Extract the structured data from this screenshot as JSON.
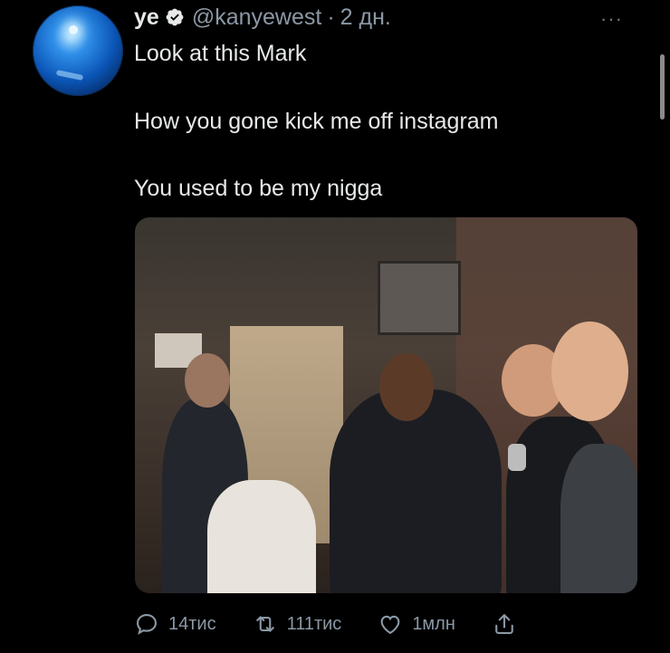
{
  "tweet": {
    "author_name": "ye",
    "verified": true,
    "handle": "@kanyewest",
    "separator": "·",
    "time": "2 дн.",
    "more_label": "···",
    "lines": [
      "Look at this Mark",
      "How you gone kick me off instagram",
      "You used to be my nigga"
    ],
    "media": {
      "description_icon": "photo"
    },
    "actions": {
      "reply_count": "14тис",
      "retweet_count": "111тис",
      "like_count": "1млн",
      "share_icon": "share-icon"
    }
  },
  "colors": {
    "background": "#000000",
    "text": "#e7e9ea",
    "secondary": "#8b98a5",
    "verified": "#e7e9ea"
  }
}
